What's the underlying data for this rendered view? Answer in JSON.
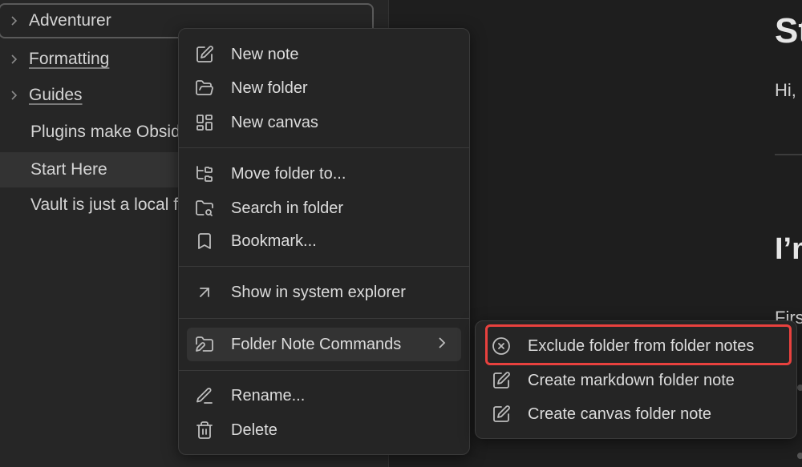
{
  "sidebar": {
    "items": [
      {
        "label": "Adventurer",
        "type": "folder",
        "state": "focused"
      },
      {
        "label": "Formatting",
        "type": "folder",
        "underlined": true
      },
      {
        "label": "Guides",
        "type": "folder",
        "underlined": true
      },
      {
        "label": "Plugins make Obsidian",
        "type": "note"
      },
      {
        "label": "Start Here",
        "type": "note",
        "state": "selected"
      },
      {
        "label": "Vault is just a local folder",
        "type": "note"
      }
    ]
  },
  "editor": {
    "title": "Start Here",
    "paragraph1": "Hi,",
    "heading2": "I’m",
    "paragraph2": "First"
  },
  "context_menu": {
    "items": [
      {
        "label": "New note",
        "icon": "edit-icon"
      },
      {
        "label": "New folder",
        "icon": "folder-open-icon"
      },
      {
        "label": "New canvas",
        "icon": "layout-dashboard-icon"
      },
      {
        "label": "Move folder to...",
        "icon": "folder-tree-icon"
      },
      {
        "label": "Search in folder",
        "icon": "folder-search-icon"
      },
      {
        "label": "Bookmark...",
        "icon": "bookmark-icon"
      },
      {
        "label": "Show in system explorer",
        "icon": "arrow-up-right-icon"
      },
      {
        "label": "Folder Note Commands",
        "icon": "folder-edit-icon",
        "has_submenu": true
      },
      {
        "label": "Rename...",
        "icon": "pencil-icon"
      },
      {
        "label": "Delete",
        "icon": "trash-icon"
      }
    ]
  },
  "submenu": {
    "items": [
      {
        "label": "Exclude folder from folder notes",
        "icon": "x-circle-icon",
        "highlighted": true
      },
      {
        "label": "Create markdown folder note",
        "icon": "edit-icon"
      },
      {
        "label": "Create canvas folder note",
        "icon": "edit-icon"
      }
    ]
  },
  "colors": {
    "highlight_border": "#e8413e",
    "menu_bg": "#252525",
    "sidebar_bg": "#262626",
    "editor_bg": "#1e1e1e"
  }
}
